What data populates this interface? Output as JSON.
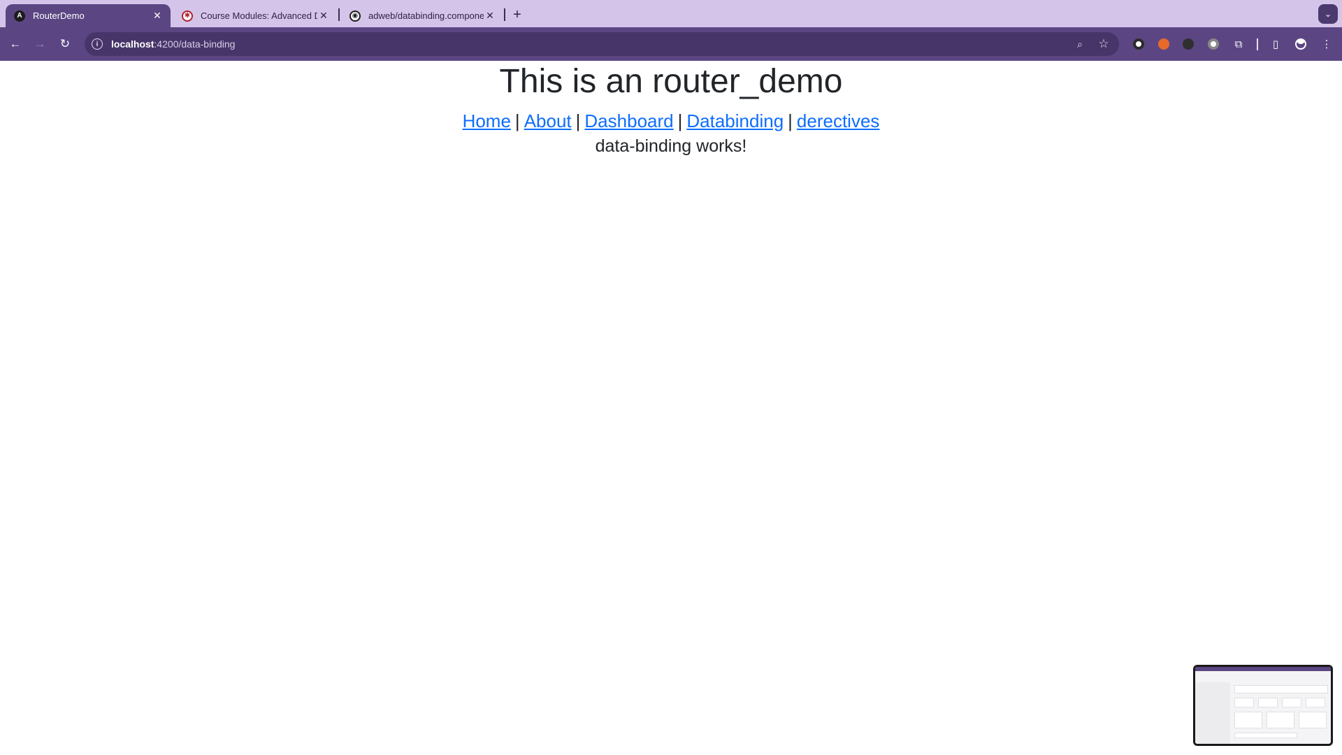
{
  "browser": {
    "tabs": [
      {
        "title": "RouterDemo",
        "favicon": "angular-icon",
        "active": true
      },
      {
        "title": "Course Modules: Advanced D",
        "favicon": "course-icon",
        "active": false
      },
      {
        "title": "adweb/databinding.compone",
        "favicon": "github-icon",
        "active": false
      }
    ],
    "address": {
      "host": "localhost",
      "path": ":4200/data-binding"
    }
  },
  "page": {
    "heading": "This is an router_demo",
    "nav": [
      {
        "label": "Home"
      },
      {
        "label": "About"
      },
      {
        "label": "Dashboard"
      },
      {
        "label": "Databinding"
      },
      {
        "label": "derectives"
      }
    ],
    "separator": "|",
    "message": "data-binding works!"
  },
  "colors": {
    "tabstrip": "#d5c4ea",
    "toolbar": "#5b4683",
    "link": "#0d6efd",
    "text": "#212529"
  }
}
